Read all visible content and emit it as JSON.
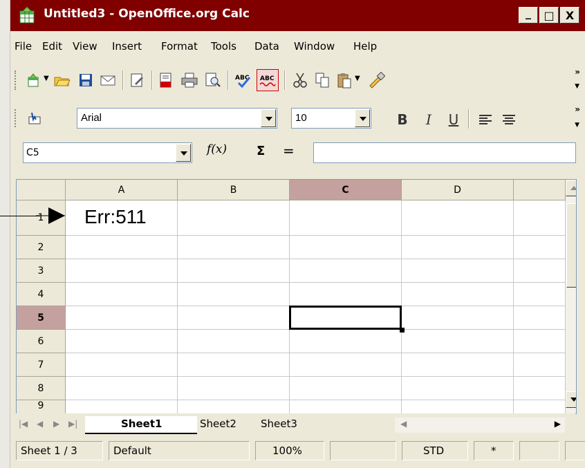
{
  "window": {
    "title": "Untitled3 - OpenOffice.org Calc",
    "buttons": [
      "_",
      "□",
      "X"
    ]
  },
  "menu": [
    "File",
    "Edit",
    "View",
    "Insert",
    "Format",
    "Tools",
    "Data",
    "Window",
    "Help"
  ],
  "standard_toolbar": {
    "icons": [
      "new-icon",
      "open-icon",
      "save-icon",
      "email-icon",
      "edit-file-icon",
      "export-pdf-icon",
      "print-icon",
      "page-preview-icon",
      "spellcheck-icon",
      "autospellcheck-icon",
      "cut-icon",
      "copy-icon",
      "paste-icon",
      "clone-format-icon"
    ]
  },
  "formatting_toolbar": {
    "font_name": "Arial",
    "font_size": "10",
    "bold": "B",
    "italic": "I",
    "underline": "U"
  },
  "formula_bar": {
    "name_box": "C5",
    "function_wizard": "f(x)",
    "sum": "Σ",
    "equals": "=",
    "formula": ""
  },
  "sheet": {
    "columns": [
      "A",
      "B",
      "C",
      "D"
    ],
    "rows": [
      "1",
      "2",
      "3",
      "4",
      "5",
      "6",
      "7",
      "8",
      "9"
    ],
    "selected_column": "C",
    "selected_row": "5",
    "cell_A1": "Err:511"
  },
  "tabs": [
    "Sheet1",
    "Sheet2",
    "Sheet3"
  ],
  "active_tab": "Sheet1",
  "status": {
    "sheet": "Sheet 1 / 3",
    "page_style": "Default",
    "zoom": "100%",
    "mode": "STD",
    "modified": "*"
  },
  "colors": {
    "titlebar": "#800000",
    "selected_header": "#c4a19e"
  }
}
